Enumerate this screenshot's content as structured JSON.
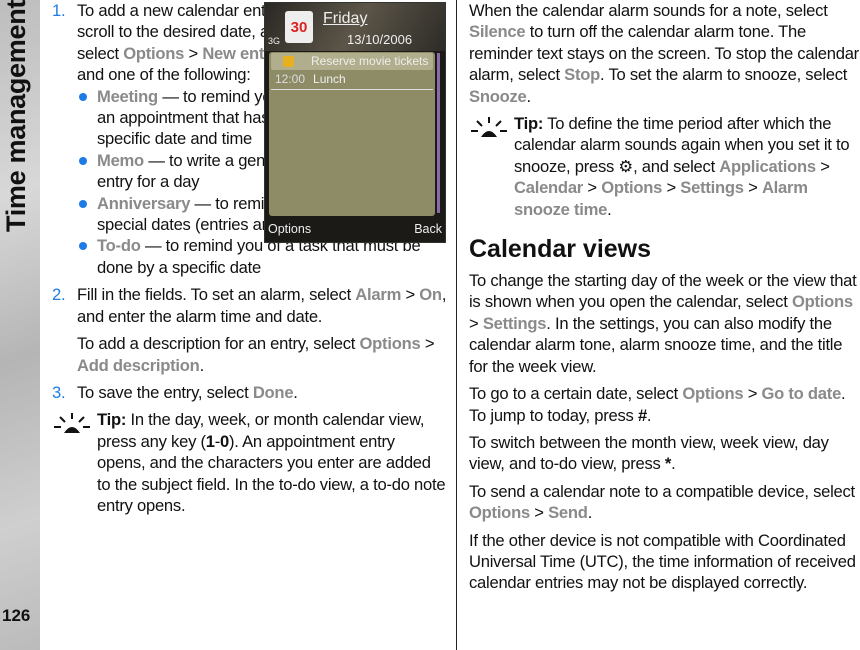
{
  "sidebar": {
    "section_title": "Time management",
    "page_number": "126"
  },
  "phone": {
    "day": "Friday",
    "date": "13/10/2006",
    "calendar_day": "30",
    "network": "3G",
    "entry1": "Reserve movie tickets",
    "entry2_time": "12:00",
    "entry2": "Lunch",
    "left_softkey": "Options",
    "right_softkey": "Back"
  },
  "left": [
    {
      "type": "step",
      "num": "1.",
      "runs": [
        [
          "To add a new calendar entry, scroll to the desired date, and select ",
          ""
        ],
        [
          "Options",
          "ui"
        ],
        [
          "  >  ",
          ""
        ],
        [
          "New entry",
          "ui"
        ],
        [
          " and one of the following:",
          ""
        ]
      ]
    },
    {
      "type": "bullet",
      "runs": [
        [
          "Meeting",
          "ui"
        ],
        [
          "  — to remind you of an appointment that has a specific date and time",
          ""
        ]
      ]
    },
    {
      "type": "bullet",
      "runs": [
        [
          "Memo",
          "ui"
        ],
        [
          " — to write a general entry for a day",
          ""
        ]
      ]
    },
    {
      "type": "bullet",
      "runs": [
        [
          "Anniversary",
          "ui"
        ],
        [
          " — to remind you of birthdays or special dates (entries are repeated annually)",
          ""
        ]
      ]
    },
    {
      "type": "bullet",
      "runs": [
        [
          "To-do",
          "ui"
        ],
        [
          " — to remind you of a task that must be done by a specific date",
          ""
        ]
      ]
    },
    {
      "type": "step",
      "num": "2.",
      "runs": [
        [
          "Fill in the fields. To set an alarm, select ",
          ""
        ],
        [
          "Alarm",
          "ui"
        ],
        [
          "  >  ",
          ""
        ],
        [
          "On",
          "ui"
        ],
        [
          ", and enter the alarm time and date.",
          ""
        ]
      ]
    },
    {
      "type": "stepcont",
      "runs": [
        [
          "To add a description for an entry, select ",
          ""
        ],
        [
          "Options",
          "ui"
        ],
        [
          "  >  ",
          ""
        ],
        [
          "Add description",
          "ui"
        ],
        [
          ".",
          ""
        ]
      ]
    },
    {
      "type": "step",
      "num": "3.",
      "runs": [
        [
          "To save the entry, select ",
          ""
        ],
        [
          "Done",
          "ui"
        ],
        [
          ".",
          ""
        ]
      ]
    },
    {
      "type": "tip",
      "runs": [
        [
          "Tip:",
          "b"
        ],
        [
          " In the day, week, or month calendar view, press any key (",
          ""
        ],
        [
          "1",
          "b"
        ],
        [
          "-",
          ""
        ],
        [
          "0",
          "b"
        ],
        [
          "). An appointment entry opens, and the characters you enter are added to the subject field. In the to-do view, a to-do note entry opens.",
          ""
        ]
      ]
    }
  ],
  "right": [
    {
      "type": "p",
      "runs": [
        [
          "When the calendar alarm sounds for a note, select ",
          ""
        ],
        [
          "Silence",
          "ui"
        ],
        [
          " to turn off the calendar alarm tone. The reminder text stays on the screen. To stop the calendar alarm, select ",
          ""
        ],
        [
          "Stop",
          "ui"
        ],
        [
          ". To set the alarm to snooze, select ",
          ""
        ],
        [
          "Snooze",
          "ui"
        ],
        [
          ".",
          ""
        ]
      ]
    },
    {
      "type": "tip",
      "runs": [
        [
          "Tip:",
          "b"
        ],
        [
          " To define the time period after which the calendar alarm sounds again when you set it to snooze, press ",
          ""
        ],
        [
          "⚙",
          "icon"
        ],
        [
          ", and select ",
          ""
        ],
        [
          "Applications",
          "ui"
        ],
        [
          "  >  ",
          ""
        ],
        [
          "Calendar",
          "ui"
        ],
        [
          "  >  ",
          ""
        ],
        [
          "Options",
          "ui"
        ],
        [
          "  >  ",
          ""
        ],
        [
          "Settings",
          "ui"
        ],
        [
          "  >  ",
          ""
        ],
        [
          "Alarm snooze time",
          "ui"
        ],
        [
          ".",
          ""
        ]
      ]
    },
    {
      "type": "h",
      "runs": [
        [
          "Calendar views",
          ""
        ]
      ]
    },
    {
      "type": "p",
      "runs": [
        [
          "To change the starting day of the week or the view that is shown when you open the calendar, select ",
          ""
        ],
        [
          "Options",
          "ui"
        ],
        [
          "  >  ",
          ""
        ],
        [
          "Settings",
          "ui"
        ],
        [
          ". In the settings, you can also modify the calendar alarm tone, alarm snooze time, and the title for the week view.",
          ""
        ]
      ]
    },
    {
      "type": "p",
      "runs": [
        [
          "To go to a certain date, select ",
          ""
        ],
        [
          "Options",
          "ui"
        ],
        [
          "  >  ",
          ""
        ],
        [
          "Go to date",
          "ui"
        ],
        [
          ". To jump to today, press ",
          ""
        ],
        [
          "#",
          "b"
        ],
        [
          ".",
          ""
        ]
      ]
    },
    {
      "type": "p",
      "runs": [
        [
          "To switch between the month view, week view, day view, and to-do view, press ",
          ""
        ],
        [
          "*",
          "b"
        ],
        [
          ".",
          ""
        ]
      ]
    },
    {
      "type": "p",
      "runs": [
        [
          "To send a calendar note to a compatible device, select ",
          ""
        ],
        [
          "Options",
          "ui"
        ],
        [
          "  >  ",
          ""
        ],
        [
          "Send",
          "ui"
        ],
        [
          ".",
          ""
        ]
      ]
    },
    {
      "type": "p",
      "runs": [
        [
          "If the other device is not compatible with Coordinated Universal Time (UTC), the time information of received calendar entries may not be displayed correctly.",
          ""
        ]
      ]
    }
  ],
  "colors": {
    "accent": "#1e7be6",
    "ui_term": "#8a8a8a"
  }
}
